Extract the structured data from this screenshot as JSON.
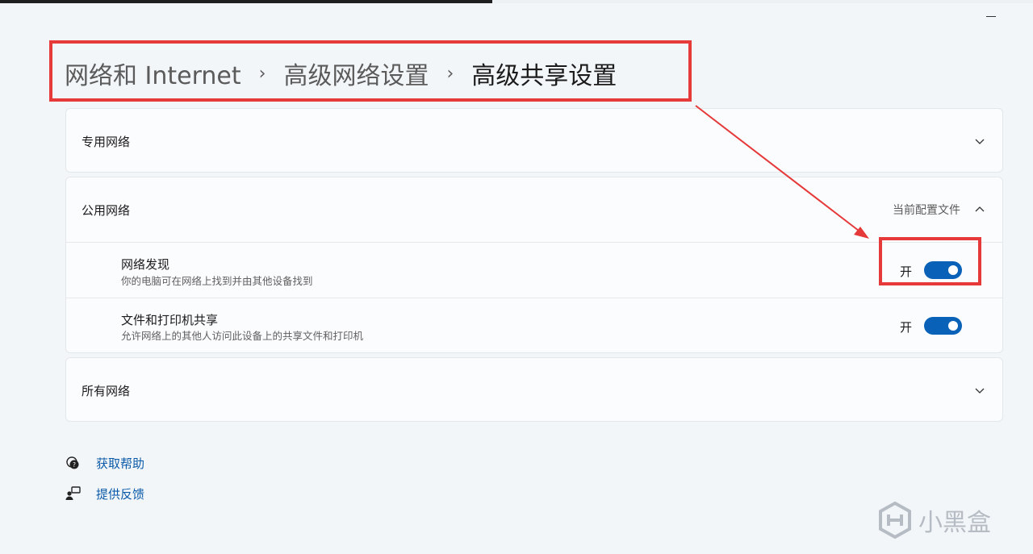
{
  "breadcrumb": {
    "items": [
      "网络和 Internet",
      "高级网络设置",
      "高级共享设置"
    ],
    "separator": "›"
  },
  "sections": {
    "private": {
      "title": "专用网络"
    },
    "public": {
      "title": "公用网络",
      "meta": "当前配置文件",
      "settings": [
        {
          "title": "网络发现",
          "desc": "你的电脑可在网络上找到并由其他设备找到",
          "state": "开",
          "on": true
        },
        {
          "title": "文件和打印机共享",
          "desc": "允许网络上的其他人访问此设备上的共享文件和打印机",
          "state": "开",
          "on": true
        }
      ]
    },
    "all": {
      "title": "所有网络"
    }
  },
  "links": {
    "help": "获取帮助",
    "feedback": "提供反馈"
  },
  "watermark": "小黑盒",
  "colors": {
    "accent": "#0a62b8",
    "annotation": "#e5393a",
    "link": "#0a5aa8"
  }
}
